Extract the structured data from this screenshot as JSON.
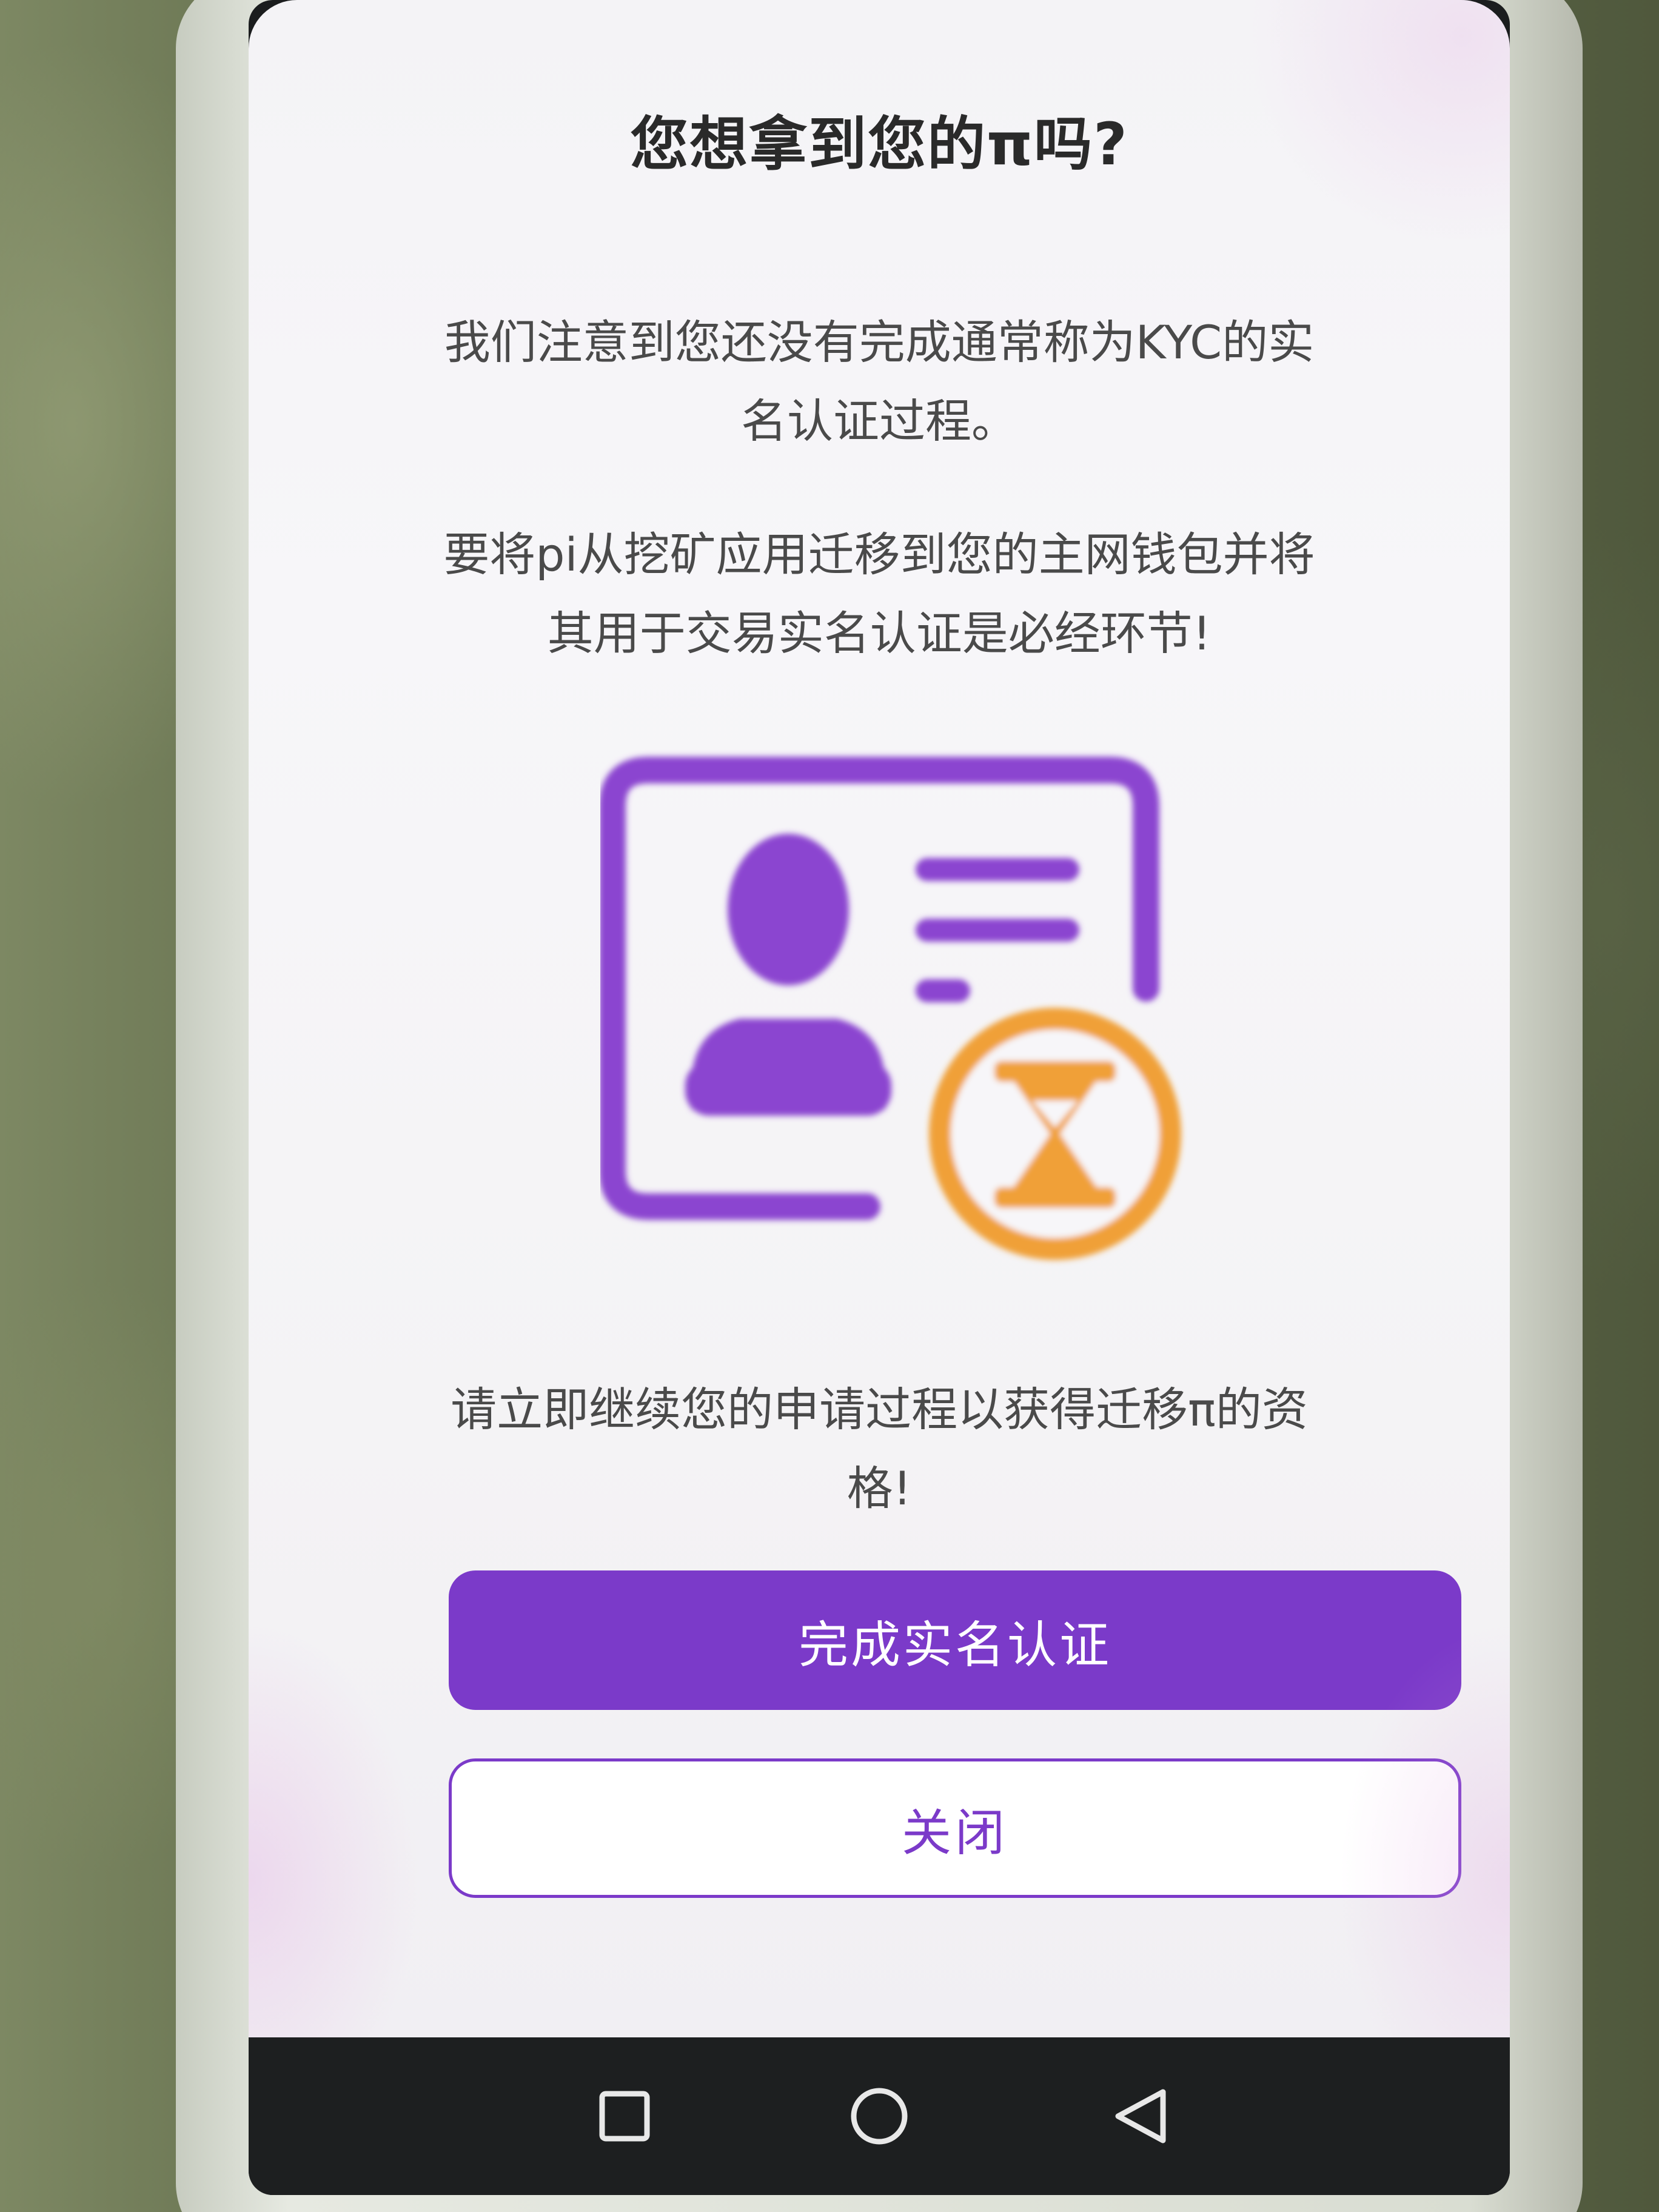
{
  "dialog": {
    "title": "您想拿到您的π吗?",
    "paragraph1": "我们注意到您还没有完成通常称为KYC的实名认证过程。",
    "paragraph2": "要将pi从挖矿应用迁移到您的主网钱包并将其用于交易实名认证是必经环节!",
    "paragraph3": "请立即继续您的申请过程以获得迁移π的资格!",
    "illustration_icon": "id-card-with-hourglass",
    "primary_button": "完成实名认证",
    "secondary_button": "关闭"
  },
  "nav": {
    "recents_icon": "square-icon",
    "home_icon": "circle-icon",
    "back_icon": "triangle-back-icon"
  },
  "colors": {
    "accent": "#7b3ac9",
    "pending": "#f0a038",
    "text": "#4a4a4a"
  }
}
